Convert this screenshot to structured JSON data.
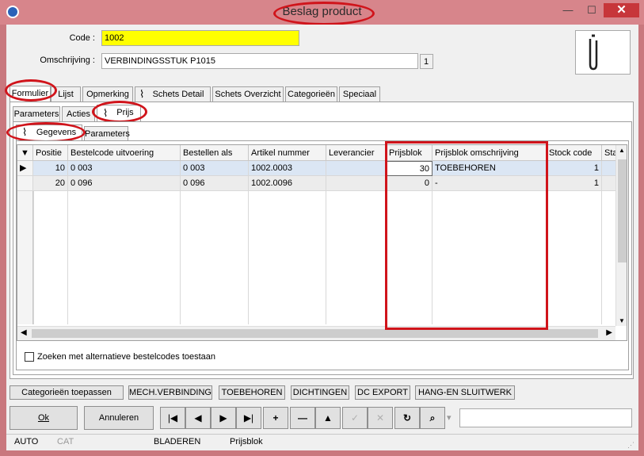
{
  "window": {
    "title": "Beslag product",
    "minimize_glyph": "—",
    "maximize_glyph": "☐",
    "close_glyph": "✕"
  },
  "form": {
    "code_label": "Code :",
    "code_value": "1002",
    "omschrijving_label": "Omschrijving :",
    "omschrijving_value": "VERBINDINGSSTUK P1015",
    "count_badge": "1",
    "thumbnail_icon": "paperclip-icon"
  },
  "main_tabs": [
    "Formulier",
    "Lijst",
    "Opmerking",
    "Schets Detail",
    "Schets Overzicht",
    "Categorieën",
    "Speciaal"
  ],
  "sub_tabs": [
    "Parameters",
    "Acties",
    "Prijs"
  ],
  "inner_tabs": [
    "Gegevens",
    "Parameters"
  ],
  "grid": {
    "columns": [
      "Positie",
      "Bestelcode uitvoering",
      "Bestellen als",
      "Artikel nummer",
      "Leverancier",
      "Prijsblok",
      "Prijsblok omschrijving",
      "Stock code",
      "Sta"
    ],
    "rows": [
      {
        "positie": "10",
        "bestelcode": "0 003",
        "bestellen_als": "0 003",
        "artikel": "1002.0003",
        "leverancier": "",
        "prijsblok": "30",
        "omschrijving": "TOEBEHOREN",
        "stock": "1"
      },
      {
        "positie": "20",
        "bestelcode": "0 096",
        "bestellen_als": "0 096",
        "artikel": "1002.0096",
        "leverancier": "",
        "prijsblok": "0",
        "omschrijving": "-",
        "stock": "1"
      }
    ]
  },
  "checkbox_label": "Zoeken met alternatieve bestelcodes toestaan",
  "category_buttons": [
    "Categorieën toepassen",
    "MECH.VERBINDING",
    "TOEBEHOREN",
    "DICHTINGEN",
    "DC EXPORT",
    "HANG-EN SLUITWERK"
  ],
  "actions": {
    "ok": "Ok",
    "annuleren": "Annuleren"
  },
  "nav_glyphs": {
    "first": "|◀",
    "prev": "◀",
    "next": "▶",
    "last": "▶|",
    "add": "+",
    "remove": "—",
    "up": "▲",
    "check": "✓",
    "cancel": "✕",
    "refresh": "↻",
    "find": "⌕",
    "dropdown": "▾"
  },
  "status": {
    "auto": "AUTO",
    "cat": "CAT",
    "mode": "BLADEREN",
    "field": "Prijsblok"
  },
  "colors": {
    "code_highlight": "#ffff00",
    "selected_row": "#dbe6f4",
    "annotation_red": "#d0141b"
  }
}
